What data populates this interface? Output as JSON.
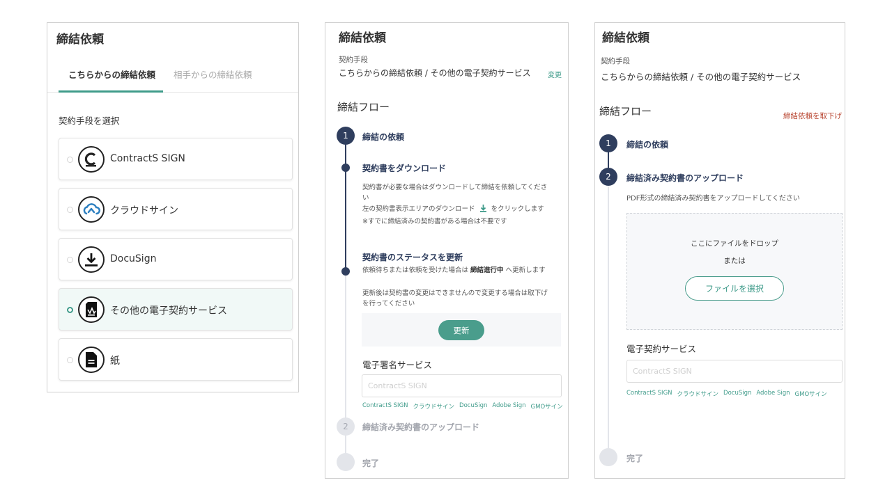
{
  "panel1": {
    "title": "締結依頼",
    "tabs": [
      {
        "label": "こちらからの締結依頼",
        "active": true
      },
      {
        "label": "相手からの締結依頼",
        "active": false
      }
    ],
    "section_label": "契約手段を選択",
    "options": [
      {
        "label": "ContractS SIGN",
        "icon": "contracts-sign-logo-icon",
        "selected": false
      },
      {
        "label": "クラウドサイン",
        "icon": "cloud-sign-logo-icon",
        "selected": false
      },
      {
        "label": "DocuSign",
        "icon": "download-logo-icon",
        "selected": false
      },
      {
        "label": "その他の電子契約サービス",
        "icon": "signed-document-icon",
        "selected": true
      },
      {
        "label": "紙",
        "icon": "paper-document-icon",
        "selected": false
      }
    ]
  },
  "panel2": {
    "title": "締結依頼",
    "method_label": "契約手段",
    "method_value": "こちらからの締結依頼 /  その他の電子契約サービス",
    "change_link": "変更",
    "flow_title": "締結フロー",
    "steps": {
      "step1": {
        "number": "1",
        "title": "締結の依頼"
      },
      "sub1": {
        "title": "契約書をダウンロード",
        "desc1": "契約書が必要な場合はダウンロードして締結を依頼してください",
        "desc2_before": "左の契約書表示エリアのダウンロード",
        "desc2_after": "をクリックします",
        "desc3": "※すでに締結済みの契約書がある場合は不要です"
      },
      "sub2": {
        "title": "契約書のステータスを更新",
        "desc1_before": "依頼待ちまたは依頼を受けた場合は",
        "desc1_bold": "締結進行中",
        "desc1_after": "へ更新します",
        "desc2": "更新後は契約書の変更はできませんので変更する場合は取下げを行ってください",
        "update_button": "更新"
      },
      "service_label": "電子署名サービス",
      "service_placeholder": "ContractS SIGN",
      "suggestions": [
        "ContractS SIGN",
        "クラウドサイン",
        "DocuSign",
        "Adobe Sign",
        "GMOサイン"
      ],
      "step2": {
        "number": "2",
        "title": "締結済み契約書のアップロード"
      },
      "step3": {
        "title": "完了"
      }
    }
  },
  "panel3": {
    "title": "締結依頼",
    "method_label": "契約手段",
    "method_value": "こちらからの締結依頼 /  その他の電子契約サービス",
    "flow_title": "締結フロー",
    "withdraw_link": "締結依頼を取下げ",
    "step1": {
      "number": "1",
      "title": "締結の依頼"
    },
    "step2": {
      "number": "2",
      "title": "締結済み契約書のアップロード",
      "desc": "PDF形式の締結済み契約書をアップロードしてください"
    },
    "dropzone": {
      "line1": "ここにファイルをドロップ",
      "line2": "または",
      "button": "ファイルを選択"
    },
    "service_label": "電子契約サービス",
    "service_placeholder": "ContractS SIGN",
    "suggestions": [
      "ContractS SIGN",
      "クラウドサイン",
      "DocuSign",
      "Adobe Sign",
      "GMOサイン"
    ],
    "step3": {
      "title": "完了"
    }
  },
  "colors": {
    "accent": "#3f9b8a",
    "step_dark": "#2f3e5e",
    "danger": "#b8442f",
    "border": "#cfcfcf"
  }
}
